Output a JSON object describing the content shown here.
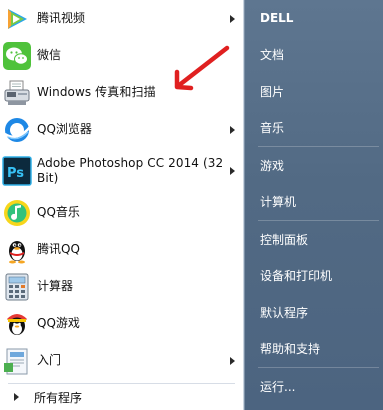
{
  "programs": [
    {
      "label": "腾讯视频",
      "icon": "tencent-video-icon",
      "submenu": true
    },
    {
      "label": "微信",
      "icon": "wechat-icon",
      "submenu": false
    },
    {
      "label": "Windows 传真和扫描",
      "icon": "fax-scanner-icon",
      "submenu": false
    },
    {
      "label": "QQ浏览器",
      "icon": "qq-browser-icon",
      "submenu": true
    },
    {
      "label": "Adobe Photoshop CC 2014 (32 Bit)",
      "icon": "photoshop-icon",
      "submenu": true
    },
    {
      "label": "QQ音乐",
      "icon": "qq-music-icon",
      "submenu": false
    },
    {
      "label": "腾讯QQ",
      "icon": "qq-penguin-icon",
      "submenu": false
    },
    {
      "label": "计算器",
      "icon": "calculator-icon",
      "submenu": false
    },
    {
      "label": "QQ游戏",
      "icon": "qq-game-icon",
      "submenu": false
    },
    {
      "label": "入门",
      "icon": "getting-started-icon",
      "submenu": true
    }
  ],
  "all_programs_label": "所有程序",
  "right_items": [
    {
      "label": "DELL",
      "bold": true
    },
    {
      "label": "文档"
    },
    {
      "label": "图片"
    },
    {
      "label": "音乐"
    },
    {
      "label": "游戏"
    },
    {
      "label": "计算机"
    },
    {
      "label": "控制面板"
    },
    {
      "label": "设备和打印机"
    },
    {
      "label": "默认程序"
    },
    {
      "label": "帮助和支持"
    },
    {
      "label": "运行..."
    }
  ],
  "colors": {
    "right_pane": "#546c86",
    "annotation_arrow": "#e02020"
  }
}
